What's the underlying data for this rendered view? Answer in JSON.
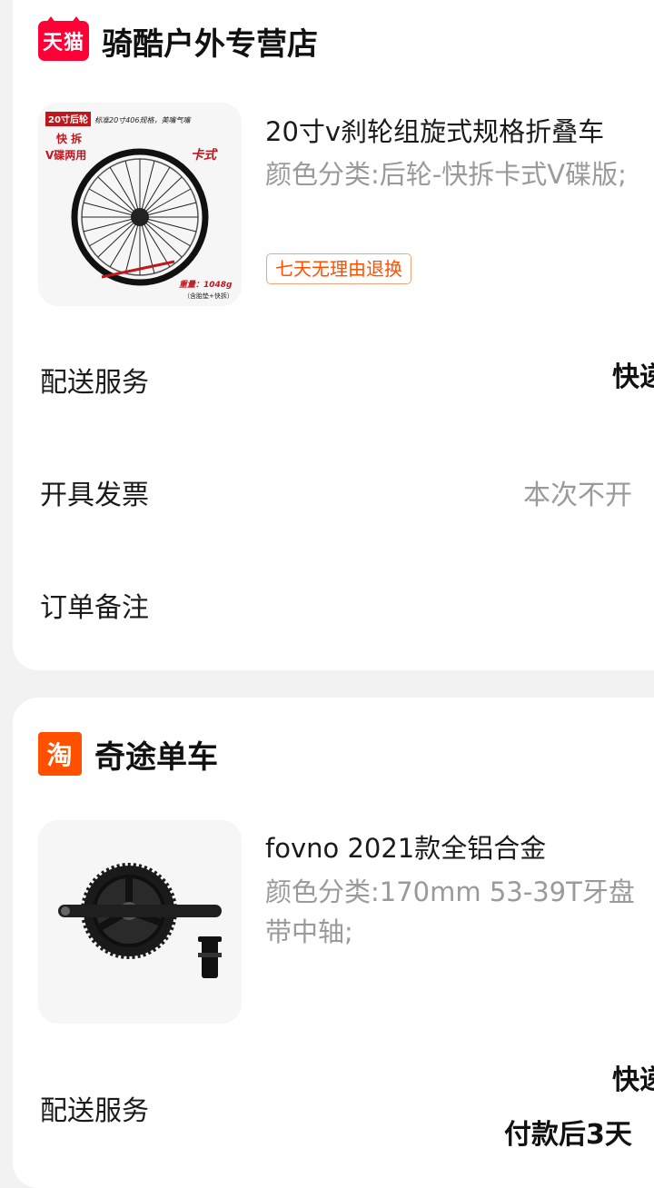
{
  "orders": [
    {
      "shop_badge": "天猫",
      "shop_name": "骑酷户外专营店",
      "product_title": "20寸v刹轮组旋式规格折叠车",
      "product_spec": "颜色分类:后轮-快拆卡式V碟版;",
      "tag": "七天无理由退换",
      "image_text": {
        "corner": "20寸后轮",
        "top_note": "标准20寸406规格，美嘴气嘴",
        "left1": "快 拆",
        "left2": "V碟两用",
        "right": "卡式",
        "weight": "重量：1048g",
        "weight_note": "（含胎垫+快拆）"
      },
      "rows": [
        {
          "label": "配送服务",
          "value": "快递"
        },
        {
          "label": "开具发票",
          "value": "本次不开"
        },
        {
          "label": "订单备注",
          "value": ""
        }
      ]
    },
    {
      "shop_badge": "淘",
      "shop_name": "奇途单车",
      "product_title": "fovno 2021款全铝合金",
      "product_spec": "颜色分类:170mm 53-39T牙盘 带中轴;",
      "rows": [
        {
          "label": "配送服务",
          "value": "快递",
          "value2": "付款后3天"
        }
      ]
    }
  ]
}
